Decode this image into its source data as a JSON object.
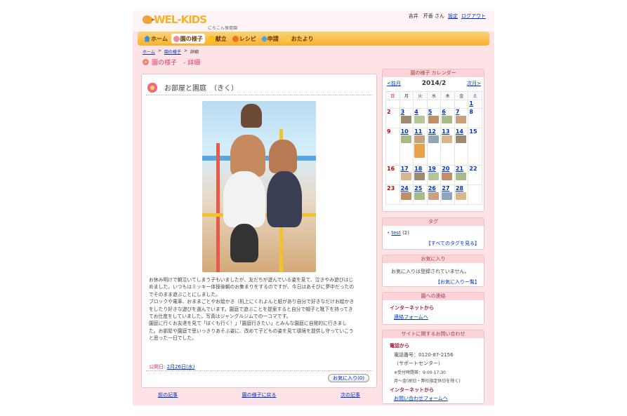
{
  "header": {
    "logo_text": "WEL-KIDS",
    "school_name": "にちこん保育園",
    "user_name": "吉井　芹香 さん",
    "settings_link": "設定",
    "logout_link": "ログアウト"
  },
  "nav": [
    {
      "label": "ホーム",
      "icon": "home-icon",
      "active": false
    },
    {
      "label": "園の様子",
      "icon": "flower-icon",
      "active": true
    },
    {
      "label": "献立",
      "icon": "menu-icon",
      "active": false
    },
    {
      "label": "レシピ",
      "icon": "recipe-icon",
      "active": false
    },
    {
      "label": "申請",
      "icon": "apply-icon",
      "active": false
    },
    {
      "label": "おたより",
      "icon": "letter-icon",
      "active": false
    }
  ],
  "breadcrumb": {
    "home": "ホーム",
    "section": "園の様子",
    "current": "詳細",
    "sep": ">"
  },
  "page_title": "園の様子　-  詳細",
  "article": {
    "title": "お部屋と園庭　（きく）",
    "body": [
      "お休み明けで朝泣いてしまう子もいましたが、友だちが遊んでいる姿を見て、泣きやみ遊びはじ",
      "めました。いつもはミッキー体操後朝のお集まりをするのですが、今日はあそびに夢中だったの",
      "でそのまま遊ぶことにしました。",
      "ブロックや電車、おままごとやお絵かき（机上にくれよんと紙があり自分で好きなだけお絵かき",
      "をしたり好きな遊びを選んでいます。園庭で遊ぶことを提案すると自分で帽子と靴下を持ってき",
      "てお仕度をしていました。写真はジャングルジムでの一コマです。",
      "園庭に行くお友達を見て「ぼくも行く！」「園庭行きたい」とみんな園庭に自発的に行きまし",
      "た。お部屋や園庭で思いっきりあそぶ姿に、改めて子どもの姿を見て環境を提供し守っていこう",
      "と思った一日でした。"
    ],
    "published_label": "公開日:",
    "published_date": "2月26日(水)",
    "favorite_button": "お気に入り(0)"
  },
  "pager": {
    "prev": "前の記事",
    "list": "園の様子に戻る",
    "next": "次の記事"
  },
  "calendar": {
    "title": "園の様子 カレンダー",
    "prev": "<前月",
    "month": "2014/2",
    "next": "次月>",
    "weekdays": [
      "日",
      "月",
      "火",
      "水",
      "木",
      "金",
      "土"
    ],
    "weeks": [
      [
        null,
        null,
        null,
        null,
        null,
        null,
        {
          "d": "1",
          "link": true
        }
      ],
      [
        {
          "d": "2"
        },
        {
          "d": "3",
          "link": true
        },
        {
          "d": "4",
          "link": true
        },
        {
          "d": "5",
          "link": true
        },
        {
          "d": "6",
          "link": true
        },
        {
          "d": "7",
          "link": true
        },
        {
          "d": "8"
        }
      ],
      [
        {
          "d": "9"
        },
        {
          "d": "10",
          "link": true
        },
        {
          "d": "11",
          "link": true
        },
        {
          "d": "12",
          "link": true
        },
        {
          "d": "13",
          "link": true
        },
        {
          "d": "14",
          "link": true
        },
        {
          "d": "15"
        }
      ],
      [
        {
          "d": "16"
        },
        {
          "d": "17",
          "link": true
        },
        {
          "d": "18",
          "link": true
        },
        {
          "d": "19",
          "link": true
        },
        {
          "d": "20",
          "link": true
        },
        {
          "d": "21",
          "link": true
        },
        {
          "d": "22"
        }
      ],
      [
        {
          "d": "23"
        },
        {
          "d": "24",
          "link": true
        },
        {
          "d": "25",
          "link": true
        },
        {
          "d": "26",
          "link": true
        },
        {
          "d": "27",
          "link": true
        },
        {
          "d": "28",
          "link": true
        },
        null
      ]
    ]
  },
  "tags": {
    "title": "タグ",
    "items": [
      {
        "name": "test",
        "count": "(2)"
      }
    ],
    "all_link": "【すべてのタグを見る】"
  },
  "favorites": {
    "title": "お気に入り",
    "message": "お気に入りは登録されていません。",
    "list_link": "【お気に入り一覧】"
  },
  "contact": {
    "title": "園への連絡",
    "heading": "インターネットから",
    "link": "連絡フォームへ"
  },
  "inquiry": {
    "title": "サイトに関するお問い合わせ",
    "phone_heading": "電話から",
    "phone": "電話番号：0120-87-2156",
    "center": "（サポートセンター）",
    "hours": "※受付時間帯：9:00-17:30",
    "days": "月〜金(祝日・弊社指定休日を除く)",
    "net_heading": "インターネットから",
    "form_link": "お問い合わせフォームへ"
  }
}
